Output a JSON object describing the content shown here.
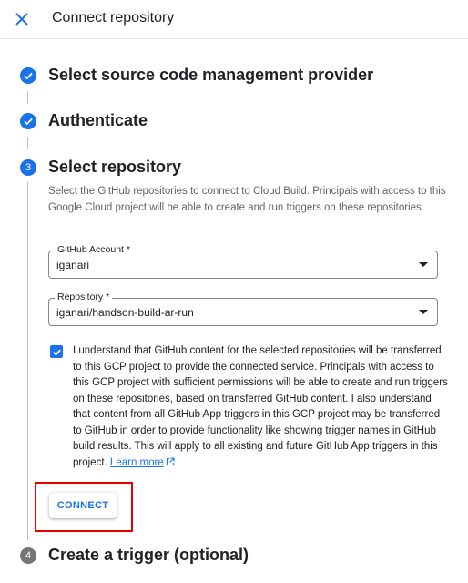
{
  "header": {
    "title": "Connect repository"
  },
  "steps": [
    {
      "number": "1",
      "title": "Select source code management provider",
      "state": "completed"
    },
    {
      "number": "2",
      "title": "Authenticate",
      "state": "completed"
    },
    {
      "number": "3",
      "title": "Select repository",
      "state": "active"
    },
    {
      "number": "4",
      "title": "Create a trigger (optional)",
      "state": "pending"
    }
  ],
  "select_repository": {
    "description": "Select the GitHub repositories to connect to Cloud Build. Principals with access to this Google Cloud project will be able to create and run triggers on these repositories.",
    "github_account": {
      "label": "GitHub Account *",
      "value": "iganari"
    },
    "repository": {
      "label": "Repository *",
      "value": "iganari/handson-build-ar-run"
    },
    "consent": {
      "checked": true,
      "text": "I understand that GitHub content for the selected repositories will be transferred to this GCP project to provide the connected service. Principals with access to this GCP project with sufficient permissions will be able to create and run triggers on these repositories, based on transferred GitHub content. I also understand that content from all GitHub App triggers in this GCP project may be transferred to GitHub in order to provide functionality like showing trigger names in GitHub build results. This will apply to all existing and future GitHub App triggers in this project.",
      "link_text": "Learn more"
    },
    "connect_label": "CONNECT"
  },
  "colors": {
    "accent": "#1a73e8",
    "highlight": "#e60000",
    "inactive_step": "#757575"
  }
}
